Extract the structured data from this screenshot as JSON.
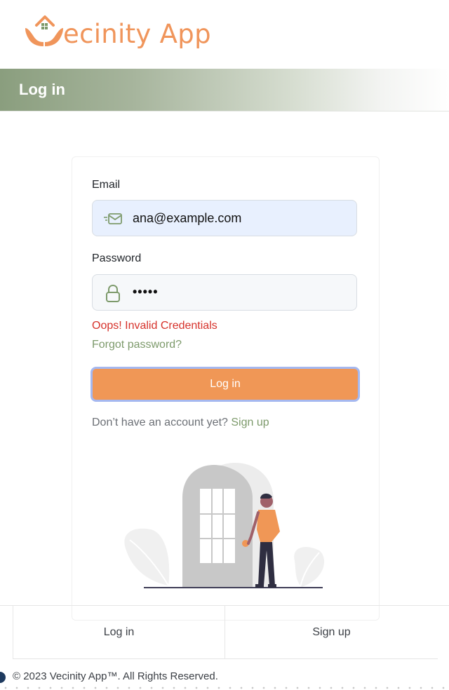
{
  "brand": {
    "name": "Vecinity App",
    "text_after_mark": "ecinity App",
    "color": "#f0955b"
  },
  "banner": {
    "title": "Log in"
  },
  "form": {
    "email_label": "Email",
    "email_value": "ana@example.com",
    "password_label": "Password",
    "password_value": "•••••",
    "error_text": "Oops! Invalid Credentials",
    "forgot_text": "Forgot password?",
    "login_button": "Log in",
    "signup_prompt": "Don’t have an account yet?",
    "signup_link": "Sign up"
  },
  "icons": {
    "email": "mail-icon",
    "password": "lock-icon"
  },
  "footer": {
    "nav": [
      "Log in",
      "Sign up"
    ],
    "copyright": "© 2023 Vecinity App™. All Rights Reserved."
  },
  "colors": {
    "accent": "#f09756",
    "green": "#7d9a6b",
    "error": "#d6322b",
    "banner": "#8a9e7e"
  }
}
